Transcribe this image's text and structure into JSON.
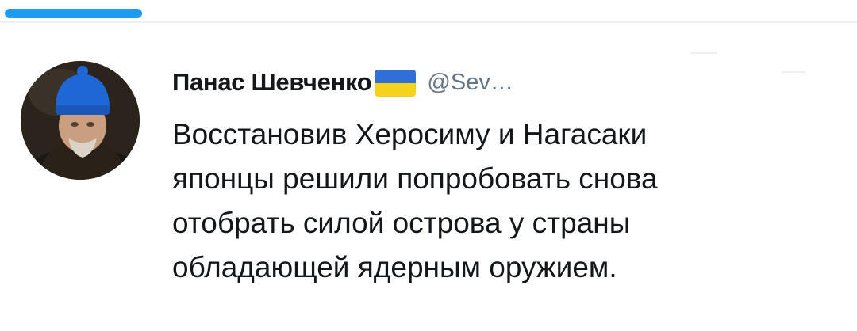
{
  "colors": {
    "accent": "#1d9bf0",
    "text_primary": "#14171a",
    "text_secondary": "#657786",
    "flag_blue": "#2f6fd6",
    "flag_yellow": "#f6d21f"
  },
  "progress": {
    "fraction": 0.16
  },
  "tweet": {
    "author": {
      "display_name": "Панас Шевченко",
      "flag_icon": "ukraine-flag-icon",
      "handle": "@Sev…"
    },
    "text_lines": [
      "Восстановив Херосиму и Нагасаки",
      "японцы решили попробовать снова",
      "отобрать силой острова у страны",
      "обладающей ядерным оружием."
    ]
  }
}
